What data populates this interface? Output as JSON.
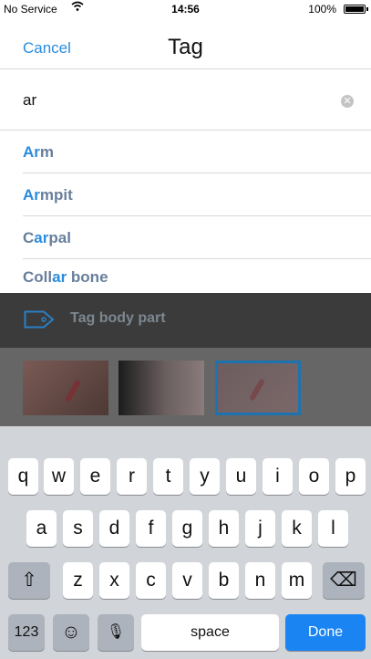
{
  "status_bar": {
    "carrier": "No Service",
    "wifi_icon": "wifi-icon",
    "time": "14:56",
    "battery": "100%"
  },
  "header": {
    "cancel_label": "Cancel",
    "title": "Tag"
  },
  "search": {
    "value": "ar",
    "clear_icon": "clear-icon"
  },
  "suggestions": [
    {
      "match": "Ar",
      "rest": "m",
      "prefix": ""
    },
    {
      "match": "Ar",
      "rest": "mpit",
      "prefix": ""
    },
    {
      "match": "ar",
      "rest": "pal",
      "prefix": "C"
    },
    {
      "match": "ar",
      "rest": " bone",
      "prefix": "Coll"
    }
  ],
  "background": {
    "tag_label": "Tag body part",
    "tag_icon": "tag-icon"
  },
  "keyboard": {
    "row1": [
      "q",
      "w",
      "e",
      "r",
      "t",
      "y",
      "u",
      "i",
      "o",
      "p"
    ],
    "row2": [
      "a",
      "s",
      "d",
      "f",
      "g",
      "h",
      "j",
      "k",
      "l"
    ],
    "row3": [
      "z",
      "x",
      "c",
      "v",
      "b",
      "n",
      "m"
    ],
    "shift_icon": "⇧",
    "delete_icon": "⌫",
    "numbers_label": "123",
    "emoji_icon": "☺",
    "mic_icon": "🎙",
    "space_label": "space",
    "done_label": "Done"
  },
  "colors": {
    "accent": "#2a8cde",
    "suggestion_text": "#687f9c",
    "done_key": "#1a84f2"
  }
}
